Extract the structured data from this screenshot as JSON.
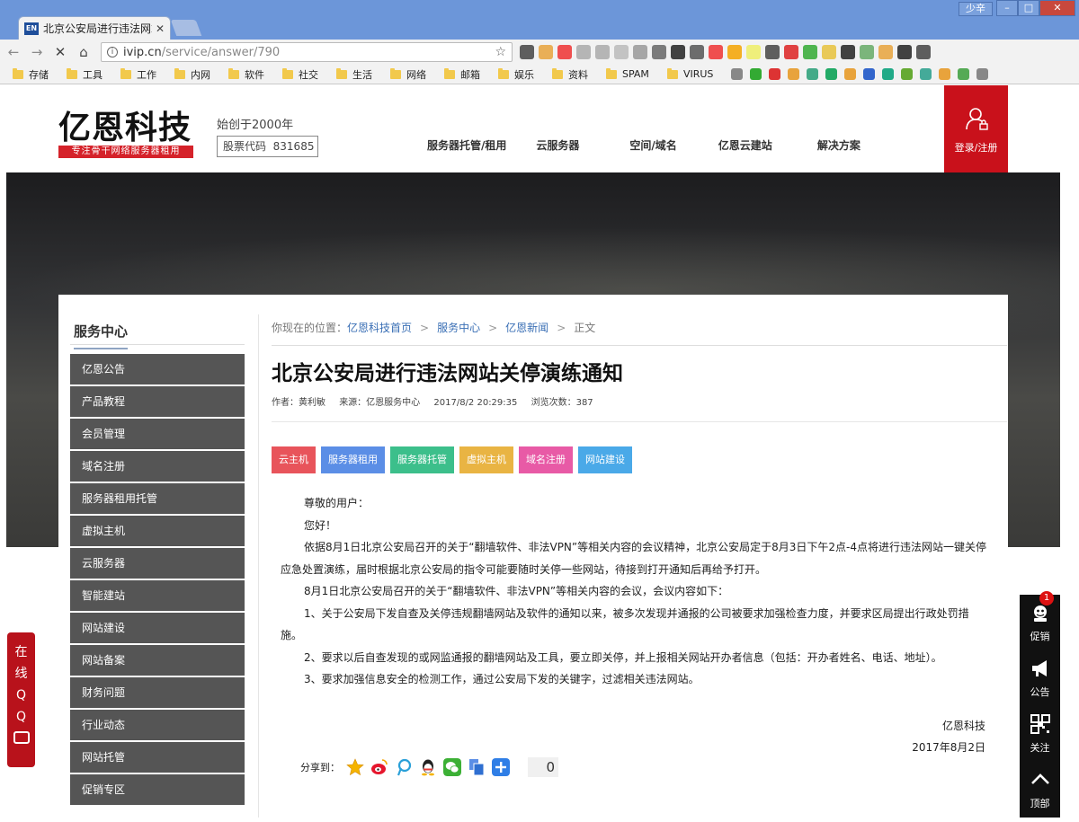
{
  "browser": {
    "tab_title": "北京公安局进行违法网站",
    "tab_favicon": "EN",
    "user_label": "少辛",
    "url_host": "ivip.cn",
    "url_path": "/service/answer/790",
    "bookmarks": [
      {
        "label": "存储",
        "type": "folder"
      },
      {
        "label": "工具",
        "type": "folder"
      },
      {
        "label": "工作",
        "type": "folder"
      },
      {
        "label": "内网",
        "type": "folder"
      },
      {
        "label": "软件",
        "type": "folder"
      },
      {
        "label": "社交",
        "type": "folder"
      },
      {
        "label": "生活",
        "type": "folder"
      },
      {
        "label": "网络",
        "type": "folder"
      },
      {
        "label": "邮箱",
        "type": "folder"
      },
      {
        "label": "娱乐",
        "type": "folder"
      },
      {
        "label": "资料",
        "type": "folder"
      },
      {
        "label": "SPAM",
        "type": "folder"
      },
      {
        "label": "VIRUS",
        "type": "folder"
      }
    ]
  },
  "site": {
    "logo_text": "亿恩科技",
    "logo_slogan": "专注骨干网络服务器租用",
    "since": "始创于2000年",
    "stock_label": "股票代码",
    "stock_code": "831685",
    "nav": [
      "服务器托管/租用",
      "云服务器",
      "空间/域名",
      "亿恩云建站",
      "解决方案"
    ],
    "login_label": "登录/注册"
  },
  "sidebar": {
    "title": "服务中心",
    "items": [
      "亿恩公告",
      "产品教程",
      "会员管理",
      "域名注册",
      "服务器租用托管",
      "虚拟主机",
      "云服务器",
      "智能建站",
      "网站建设",
      "网站备案",
      "财务问题",
      "行业动态",
      "网站托管",
      "促销专区"
    ]
  },
  "breadcrumb": {
    "prefix": "你现在的位置：",
    "links": [
      "亿恩科技首页",
      "服务中心",
      "亿恩新闻"
    ],
    "sep": ">",
    "current": "正文"
  },
  "article": {
    "title": "北京公安局进行违法网站关停演练通知",
    "author": "作者：黄利敏",
    "source": "来源：亿恩服务中心",
    "date": "2017/8/2 20:29:35",
    "views": "浏览次数：387",
    "tags": [
      {
        "label": "云主机",
        "color": "#e8545b"
      },
      {
        "label": "服务器租用",
        "color": "#5b8ee6"
      },
      {
        "label": "服务器托管",
        "color": "#3cbf8b"
      },
      {
        "label": "虚拟主机",
        "color": "#e9b443"
      },
      {
        "label": "域名注册",
        "color": "#e85aa6"
      },
      {
        "label": "网站建设",
        "color": "#4aa9e8"
      }
    ],
    "paragraphs": [
      "尊敬的用户：",
      "您好！",
      "依据8月1日北京公安局召开的关于“翻墙软件、非法VPN”等相关内容的会议精神，北京公安局定于8月3日下午2点-4点将进行违法网站一键关停应急处置演练，届时根据北京公安局的指令可能要随时关停一些网站，待接到打开通知后再给予打开。",
      "8月1日北京公安局召开的关于“翻墙软件、非法VPN”等相关内容的会议，会议内容如下：",
      "1、关于公安局下发自查及关停违规翻墙网站及软件的通知以来，被多次发现并通报的公司被要求加强检查力度，并要求区局提出行政处罚措施。",
      "2、要求以后自查发现的或网监通报的翻墙网站及工具，要立即关停，并上报相关网站开办者信息（包括：开办者姓名、电话、地址）。",
      "3、要求加强信息安全的检测工作，通过公安局下发的关键字，过滤相关违法网站。"
    ],
    "signature": "亿恩科技",
    "sign_date": "2017年8月2日",
    "share_label": "分享到：",
    "share_count": "0"
  },
  "float_left": {
    "chars": [
      "在",
      "线",
      "Q",
      "Q"
    ]
  },
  "float_right": {
    "items": [
      {
        "label": "促销",
        "badge": "1"
      },
      {
        "label": "公告"
      },
      {
        "label": "关注"
      },
      {
        "label": "顶部"
      }
    ]
  }
}
